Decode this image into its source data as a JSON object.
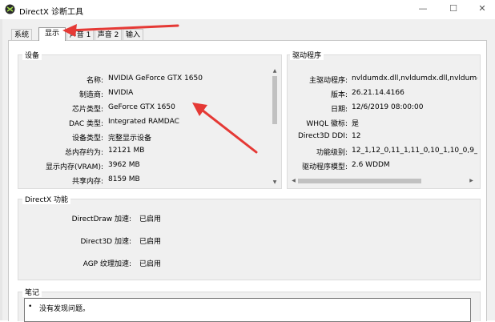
{
  "window": {
    "title": "DirectX 诊断工具",
    "minimize": "—",
    "maximize": "☐",
    "close": "✕"
  },
  "tabs": [
    {
      "label": "系统"
    },
    {
      "label": "显示"
    },
    {
      "label": "声音 1"
    },
    {
      "label": "声音 2"
    },
    {
      "label": "输入"
    }
  ],
  "device": {
    "group_label": "设备",
    "rows": [
      {
        "label": "名称:",
        "value": "NVIDIA GeForce GTX 1650"
      },
      {
        "label": "制造商:",
        "value": "NVIDIA"
      },
      {
        "label": "芯片类型:",
        "value": "GeForce GTX 1650"
      },
      {
        "label": "DAC 类型:",
        "value": "Integrated RAMDAC"
      },
      {
        "label": "设备类型:",
        "value": "完整显示设备"
      },
      {
        "label": "总内存约为:",
        "value": "12121 MB"
      },
      {
        "label": "显示内存(VRAM):",
        "value": "3962 MB"
      },
      {
        "label": "共享内存:",
        "value": "8159 MB"
      }
    ]
  },
  "driver": {
    "group_label": "驱动程序",
    "rows": [
      {
        "label": "主驱动程序:",
        "value": "nvldumdx.dll,nvldumdx.dll,nvldumdx.c"
      },
      {
        "label": "版本:",
        "value": "26.21.14.4166"
      },
      {
        "label": "日期:",
        "value": "12/6/2019 08:00:00"
      },
      {
        "label": "WHQL 徽标:",
        "value": "是"
      },
      {
        "label": "Direct3D DDI:",
        "value": "12"
      },
      {
        "label": "功能级别:",
        "value": "12_1,12_0,11_1,11_0,10_1,10_0,9_3,9_2"
      },
      {
        "label": "驱动程序模型:",
        "value": "2.6 WDDM"
      }
    ]
  },
  "directx": {
    "group_label": "DirectX 功能",
    "rows": [
      {
        "label": "DirectDraw 加速:",
        "value": "已启用"
      },
      {
        "label": "Direct3D 加速:",
        "value": "已启用"
      },
      {
        "label": "AGP 纹理加速:",
        "value": "已启用"
      }
    ]
  },
  "notes": {
    "group_label": "笔记",
    "items": [
      "没有发现问题。"
    ]
  },
  "colors": {
    "annotation_arrow": "#e53935",
    "window_bg": "#f0f0f0",
    "panel_bg": "#ffffff"
  },
  "icons": {
    "app": "directx-icon",
    "scroll_up": "▲",
    "scroll_down": "▼",
    "scroll_left": "◀",
    "scroll_right": "▶",
    "bullet": "•"
  }
}
